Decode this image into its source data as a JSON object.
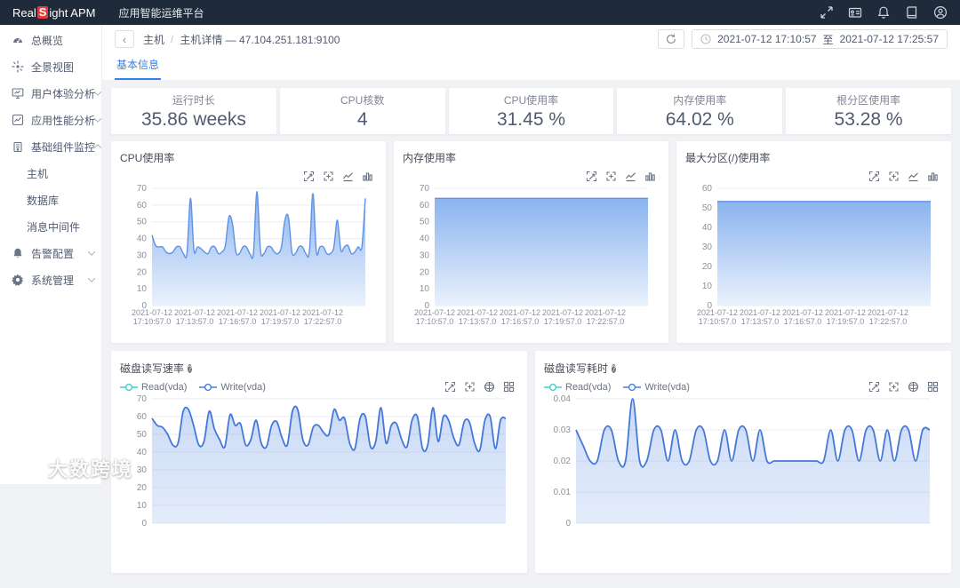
{
  "navbar": {
    "brand_pre": "Real",
    "brand_accent": "S",
    "brand_post": "ight APM",
    "product": "应用智能运维平台",
    "icons": [
      "expand-icon",
      "id-card-icon",
      "bell-icon",
      "manual-icon",
      "user-icon"
    ]
  },
  "sidebar": {
    "items": [
      {
        "label": "总概览",
        "icon": "overview-icon"
      },
      {
        "label": "全景视图",
        "icon": "panorama-icon"
      },
      {
        "label": "用户体验分析",
        "icon": "user-experience-icon",
        "chevron": "down"
      },
      {
        "label": "应用性能分析",
        "icon": "app-performance-icon",
        "chevron": "down"
      },
      {
        "label": "基础组件监控",
        "icon": "component-monitor-icon",
        "chevron": "up",
        "children": [
          "主机",
          "数据库",
          "消息中间件"
        ]
      },
      {
        "label": "告警配置",
        "icon": "alarm-bell-icon",
        "chevron": "down"
      },
      {
        "label": "系统管理",
        "icon": "gear-icon",
        "chevron": "down"
      }
    ]
  },
  "header": {
    "back_symbol": "‹",
    "breadcrumb": {
      "root": "主机",
      "separator": "/",
      "current": "主机详情 — 47.104.251.181:9100"
    },
    "time_range": {
      "start": "2021-07-12 17:10:57",
      "to_label": "至",
      "end": "2021-07-12 17:25:57"
    }
  },
  "tabs": [
    {
      "label": "基本信息",
      "active": true
    }
  ],
  "stats": [
    {
      "label": "运行时长",
      "value": "35.86 weeks"
    },
    {
      "label": "CPU核数",
      "value": "4"
    },
    {
      "label": "CPU使用率",
      "value": "31.45 %"
    },
    {
      "label": "内存使用率",
      "value": "64.02 %"
    },
    {
      "label": "根分区使用率",
      "value": "53.28 %"
    }
  ],
  "watermark": {
    "text": "大数跨境"
  },
  "colors": {
    "accent_blue": "#3580f0",
    "navbar_bg": "#1f2a3a",
    "brand_red": "#e23c3c",
    "area_line": "#5e92e8",
    "area_fill_top": "#84afef",
    "area_fill_bottom": "#e7f0fc",
    "pulse_line": "#4478d8",
    "legend_read": "#41d1c6",
    "legend_write": "#477de0"
  },
  "chart_data": [
    {
      "type": "area",
      "title": "CPU使用率",
      "toolbox": [
        "zoom",
        "restore",
        "line-chart",
        "bar-chart"
      ],
      "ylim": [
        0,
        70
      ],
      "ytick_step": 10,
      "grid": true,
      "decimals": 0,
      "x_labels": [
        "2021-07-12 17:10:57.0",
        "2021-07-12 17:13:57.0",
        "2021-07-12 17:16:57.0",
        "2021-07-12 17:19:57.0",
        "2021-07-12 17:22:57.0"
      ],
      "values": [
        42,
        36,
        35,
        35,
        32,
        31,
        32,
        35,
        35,
        31,
        31,
        64,
        33,
        35,
        34,
        32,
        31,
        35,
        35,
        31,
        32,
        36,
        53,
        49,
        32,
        31,
        35,
        35,
        31,
        31,
        68,
        33,
        31,
        35,
        35,
        32,
        31,
        35,
        51,
        53,
        32,
        31,
        35,
        35,
        31,
        32,
        67,
        32,
        35,
        35,
        31,
        31,
        35,
        51,
        33,
        35,
        36,
        31,
        32,
        35,
        35,
        64
      ],
      "style": "gradient"
    },
    {
      "type": "area",
      "title": "内存使用率",
      "toolbox": [
        "zoom",
        "restore",
        "line-chart",
        "bar-chart"
      ],
      "ylim": [
        0,
        70
      ],
      "ytick_step": 10,
      "grid": true,
      "decimals": 0,
      "x_labels": [
        "2021-07-12 17:10:57.0",
        "2021-07-12 17:13:57.0",
        "2021-07-12 17:16:57.0",
        "2021-07-12 17:19:57.0",
        "2021-07-12 17:22:57.0"
      ],
      "values": [
        64.02,
        64.02,
        64.02,
        64.02,
        64.02,
        64.02,
        64.02,
        64.02,
        64.02,
        64.02,
        64.02
      ],
      "style": "gradient"
    },
    {
      "type": "area",
      "title": "最大分区(/)使用率",
      "toolbox": [
        "zoom",
        "restore",
        "line-chart",
        "bar-chart"
      ],
      "ylim": [
        0,
        60
      ],
      "ytick_step": 10,
      "grid": true,
      "decimals": 0,
      "x_labels": [
        "2021-07-12 17:10:57.0",
        "2021-07-12 17:13:57.0",
        "2021-07-12 17:16:57.0",
        "2021-07-12 17:19:57.0",
        "2021-07-12 17:22:57.0"
      ],
      "values": [
        53.28,
        53.28,
        53.28,
        53.28,
        53.28,
        53.28,
        53.28,
        53.28,
        53.28,
        53.28,
        53.28
      ],
      "style": "gradient"
    },
    {
      "type": "line",
      "title": "磁盘读写速率",
      "help": true,
      "legend": [
        {
          "name": "Read(vda)",
          "color": "#41d1c6"
        },
        {
          "name": "Write(vda)",
          "color": "#477de0"
        }
      ],
      "toolbox": [
        "zoom",
        "restore",
        "sphere",
        "tiled"
      ],
      "ylim": [
        0,
        70
      ],
      "ytick_step": 10,
      "grid": true,
      "decimals": 0,
      "x_labels": [],
      "values": [
        59,
        55,
        54,
        50,
        44,
        45,
        63,
        64,
        55,
        44,
        46,
        63,
        53,
        47,
        43,
        61,
        55,
        56,
        44,
        47,
        58,
        45,
        43,
        55,
        57,
        48,
        44,
        63,
        64,
        47,
        44,
        54,
        55,
        51,
        50,
        64,
        58,
        59,
        45,
        42,
        59,
        60,
        43,
        46,
        65,
        45,
        55,
        56,
        47,
        43,
        58,
        60,
        42,
        44,
        65,
        46,
        60,
        58,
        48,
        44,
        57,
        57,
        45,
        41,
        58,
        60,
        42,
        58,
        59
      ],
      "style": "pulse"
    },
    {
      "type": "line",
      "title": "磁盘读写耗时",
      "help": true,
      "legend": [
        {
          "name": "Read(vda)",
          "color": "#41d1c6"
        },
        {
          "name": "Write(vda)",
          "color": "#477de0"
        }
      ],
      "toolbox": [
        "zoom",
        "restore",
        "sphere",
        "tiled"
      ],
      "ylim": [
        0,
        0.04
      ],
      "ytick_step": 0.01,
      "grid": true,
      "decimals": 2,
      "x_labels": [],
      "values": [
        0.03,
        0.025,
        0.02,
        0.02,
        0.03,
        0.03,
        0.02,
        0.02,
        0.04,
        0.02,
        0.02,
        0.03,
        0.03,
        0.02,
        0.03,
        0.02,
        0.02,
        0.03,
        0.03,
        0.02,
        0.02,
        0.03,
        0.02,
        0.03,
        0.03,
        0.02,
        0.03,
        0.02,
        0.02,
        0.02,
        0.02,
        0.02,
        0.02,
        0.02,
        0.02,
        0.02,
        0.03,
        0.02,
        0.03,
        0.03,
        0.02,
        0.03,
        0.03,
        0.02,
        0.03,
        0.02,
        0.03,
        0.03,
        0.02,
        0.03,
        0.03
      ],
      "style": "pulse"
    }
  ]
}
